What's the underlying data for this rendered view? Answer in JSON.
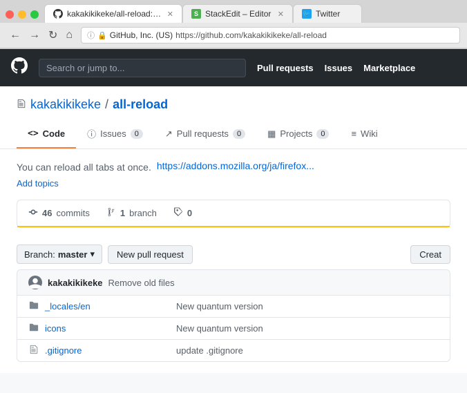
{
  "window": {
    "controls": {
      "red": "●",
      "yellow": "●",
      "green": "●"
    }
  },
  "tabs": [
    {
      "id": "github",
      "favicon": "gh",
      "title": "kakakikikeke/all-reload: You ca",
      "active": true
    },
    {
      "id": "stackedit",
      "favicon": "se",
      "title": "StackEdit – Editor",
      "active": false
    },
    {
      "id": "twitter",
      "favicon": "tw",
      "title": "Twitter",
      "active": false
    }
  ],
  "address_bar": {
    "lock_text": "🔒",
    "org": "GitHub, Inc. (US)",
    "url": "https://github.com/kakakikikeke/all-reload"
  },
  "nav": {
    "logo": "🐙",
    "search_placeholder": "Search or jump to...",
    "kbd": "/",
    "links": [
      "Pull requests",
      "Issues",
      "Marketplace"
    ]
  },
  "repo": {
    "icon": "📋",
    "owner": "kakakikikeke",
    "separator": "/",
    "name": "all-reload",
    "tabs": [
      {
        "id": "code",
        "icon": "<>",
        "label": "Code",
        "badge": null,
        "active": true
      },
      {
        "id": "issues",
        "icon": "ℹ",
        "label": "Issues",
        "badge": "0",
        "active": false
      },
      {
        "id": "pullrequests",
        "icon": "↗",
        "label": "Pull requests",
        "badge": "0",
        "active": false
      },
      {
        "id": "projects",
        "icon": "▦",
        "label": "Projects",
        "badge": "0",
        "active": false
      },
      {
        "id": "wiki",
        "icon": "≡",
        "label": "Wiki",
        "badge": null,
        "active": false
      }
    ],
    "description": "You can reload all tabs at once.",
    "description_link": "https://addons.mozilla.org/ja/firefox...",
    "add_topics": "Add topics",
    "stats": {
      "commits": {
        "icon": "🕐",
        "count": "46",
        "label": "commits"
      },
      "branches": {
        "icon": "⑂",
        "count": "1",
        "label": "branch"
      },
      "tags": {
        "icon": "🏷",
        "count": "0",
        "label": ""
      }
    },
    "branch": {
      "label": "Branch:",
      "value": "master",
      "chevron": "▾"
    },
    "buttons": {
      "new_pull_request": "New pull request",
      "create": "Creat"
    },
    "commit_row": {
      "user": "kakakikikeke",
      "message": "Remove old files"
    },
    "files": [
      {
        "icon": "📁",
        "name": "_locales/en",
        "commit": "New quantum version",
        "time": ""
      },
      {
        "icon": "📁",
        "name": "icons",
        "commit": "New quantum version",
        "time": ""
      },
      {
        "icon": "📄",
        "name": ".gitignore",
        "commit": "update .gitignore",
        "time": ""
      }
    ]
  }
}
